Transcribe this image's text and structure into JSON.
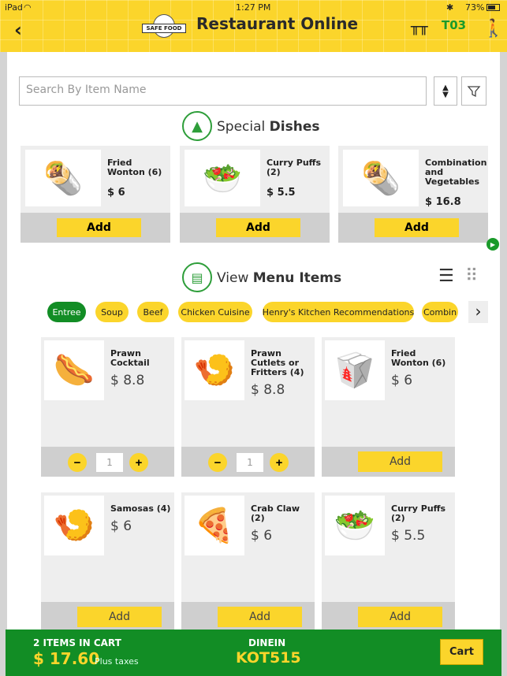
{
  "status_bar": {
    "device": "iPad",
    "time": "1:27 PM",
    "battery": "73%"
  },
  "header": {
    "title": "Restaurant Online",
    "logo_text": "SAFE FOOD",
    "table": "T03"
  },
  "search": {
    "placeholder": "Search By Item Name"
  },
  "special": {
    "prefix": "Special",
    "bold": "Dishes",
    "items": [
      {
        "name": "Fried Wonton (6)",
        "price": "$ 6",
        "add": "Add"
      },
      {
        "name": "Curry Puffs (2)",
        "price": "$ 5.5",
        "add": "Add"
      },
      {
        "name": "Combination and Vegetables",
        "price": "$ 16.8",
        "add": "Add"
      }
    ]
  },
  "menu": {
    "prefix": "View",
    "bold": "Menu Items",
    "categories": [
      "Entree",
      "Soup",
      "Beef",
      "Chicken Cuisine",
      "Henry's Kitchen Recommendations",
      "Combin"
    ],
    "items": [
      {
        "name": "Prawn Cocktail",
        "price": "$ 8.8",
        "qty": "1"
      },
      {
        "name": "Prawn Cutlets or Fritters (4)",
        "price": "$ 8.8",
        "qty": "1"
      },
      {
        "name": "Fried Wonton (6)",
        "price": "$ 6",
        "add": "Add"
      },
      {
        "name": "Samosas (4)",
        "price": "$ 6",
        "add": "Add"
      },
      {
        "name": "Crab Claw (2)",
        "price": "$ 6",
        "add": "Add"
      },
      {
        "name": "Curry Puffs (2)",
        "price": "$ 5.5",
        "add": "Add"
      }
    ]
  },
  "cart": {
    "count": "2 ITEMS IN CART",
    "total": "$ 17.60",
    "taxes": "Plus taxes",
    "mode": "DINEIN",
    "kot": "KOT515",
    "button": "Cart"
  },
  "colors": {
    "yellow": "#fbd52b",
    "green": "#128d25"
  }
}
